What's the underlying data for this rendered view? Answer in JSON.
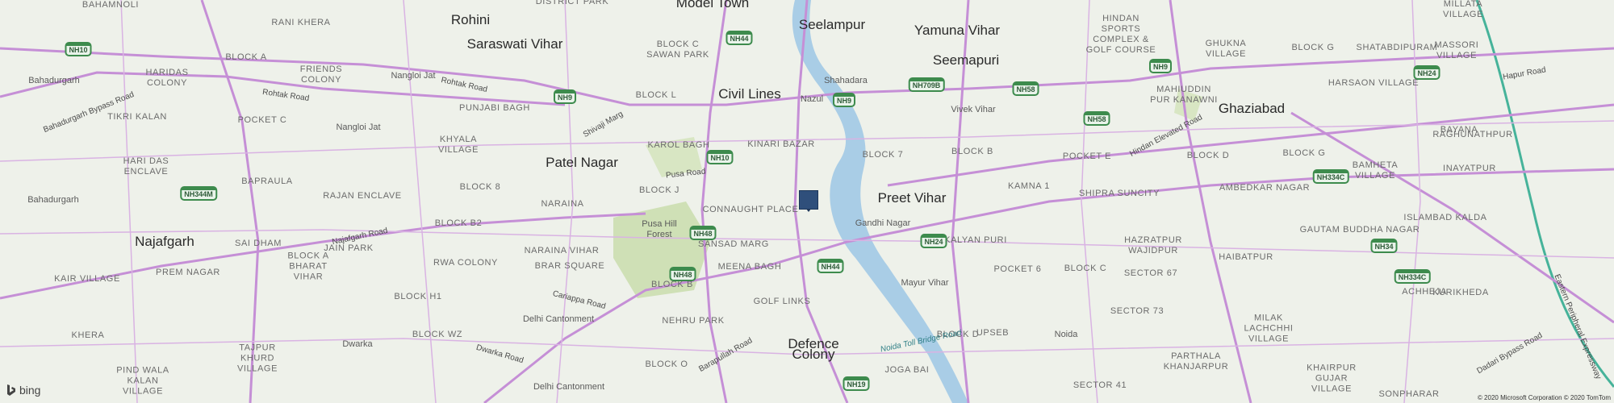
{
  "map": {
    "cities": [
      {
        "text": "Rohini"
      },
      {
        "text": "Saraswati Vihar"
      },
      {
        "text": "Model Town"
      },
      {
        "text": "Seelampur"
      },
      {
        "text": "Yamuna Vihar"
      },
      {
        "text": "Seemapuri"
      },
      {
        "text": "Civil Lines"
      },
      {
        "text": "Patel Nagar"
      },
      {
        "text": "Preet Vihar"
      },
      {
        "text": "Najafgarh"
      },
      {
        "text": "Defence Colony"
      },
      {
        "text": "Ghaziabad"
      }
    ],
    "localities": [
      {
        "text": "Bahadurgarh"
      },
      {
        "text": "Nangloi Jat"
      },
      {
        "text": "Nangloi Jat"
      },
      {
        "text": "Bahadurgarh"
      },
      {
        "text": "Shahadara"
      },
      {
        "text": "Nazul"
      },
      {
        "text": "Vivek Vihar"
      },
      {
        "text": "Gandhi Nagar"
      },
      {
        "text": "Mayur Vihar"
      },
      {
        "text": "Delhi Cantonment"
      },
      {
        "text": "Dwarka"
      },
      {
        "text": "Noida"
      },
      {
        "text": "Delhi Cantonment"
      },
      {
        "text": "Pusa Hill Forest"
      }
    ],
    "areas": [
      {
        "text": "BAHAMNOLI"
      },
      {
        "text": "RANI KHERA"
      },
      {
        "text": "DISTRICT PARK"
      },
      {
        "text": "BLOCK C SAWAN PARK"
      },
      {
        "text": "HARIDAS COLONY"
      },
      {
        "text": "BLOCK A"
      },
      {
        "text": "FRIENDS COLONY"
      },
      {
        "text": "PUNJABI BAGH"
      },
      {
        "text": "BLOCK L"
      },
      {
        "text": "TIKRI KALAN"
      },
      {
        "text": "POCKET C"
      },
      {
        "text": "KHYALA VILLAGE"
      },
      {
        "text": "KAROL BAGH"
      },
      {
        "text": "KINARI BAZAR"
      },
      {
        "text": "HARI DAS ENCLAVE"
      },
      {
        "text": "BAPRAULA"
      },
      {
        "text": "BLOCK 8"
      },
      {
        "text": "BLOCK J"
      },
      {
        "text": "RAJAN ENCLAVE"
      },
      {
        "text": "NARAINA"
      },
      {
        "text": "CONNAUGHT PLACE"
      },
      {
        "text": "BLOCK B2"
      },
      {
        "text": "SAI DHAM"
      },
      {
        "text": "JAIN PARK"
      },
      {
        "text": "BLOCK A BHARAT VIHAR"
      },
      {
        "text": "RWA COLONY"
      },
      {
        "text": "NARAINA VIHAR"
      },
      {
        "text": "SANSAD MARG"
      },
      {
        "text": "BRAR SQUARE"
      },
      {
        "text": "KAIR VILLAGE"
      },
      {
        "text": "PREM NAGAR"
      },
      {
        "text": "MEENA BAGH"
      },
      {
        "text": "BLOCK B"
      },
      {
        "text": "BLOCK H1"
      },
      {
        "text": "GOLF LINKS"
      },
      {
        "text": "KHERA"
      },
      {
        "text": "BLOCK WZ"
      },
      {
        "text": "NEHRU PARK"
      },
      {
        "text": "TAJPUR KHURD VILLAGE"
      },
      {
        "text": "PIND WALA KALAN VILLAGE"
      },
      {
        "text": "BLOCK O"
      },
      {
        "text": "BLOCK 7"
      },
      {
        "text": "BLOCK B"
      },
      {
        "text": "POCKET E"
      },
      {
        "text": "KAMNA 1"
      },
      {
        "text": "SHIPRA SUNCITY"
      },
      {
        "text": "KALYAN PURI"
      },
      {
        "text": "POCKET 6"
      },
      {
        "text": "BLOCK C"
      },
      {
        "text": "HAZRATPUR WAJIDPUR"
      },
      {
        "text": "SECTOR 67"
      },
      {
        "text": "SECTOR 73"
      },
      {
        "text": "UPSEB"
      },
      {
        "text": "BLOCK D"
      },
      {
        "text": "PARTHALA KHANJARPUR"
      },
      {
        "text": "JOGA BAI"
      },
      {
        "text": "SECTOR 41"
      },
      {
        "text": "HINDAN SPORTS COMPLEX & GOLF COURSE"
      },
      {
        "text": "GHUKNA VILLAGE"
      },
      {
        "text": "MAHIUDDIN PUR KANAWNI"
      },
      {
        "text": "BLOCK G"
      },
      {
        "text": "SHATABDIPURAM"
      },
      {
        "text": "HARSAON VILLAGE"
      },
      {
        "text": "BLOCK D"
      },
      {
        "text": "BLOCK G"
      },
      {
        "text": "BAMHETA VILLAGE"
      },
      {
        "text": "AMBEDKAR NAGAR"
      },
      {
        "text": "GAUTAM BUDDHA NAGAR"
      },
      {
        "text": "HAIBATPUR"
      },
      {
        "text": "MILAK LACHCHHI VILLAGE"
      },
      {
        "text": "KHAIRPUR GUJAR VILLAGE"
      },
      {
        "text": "SONPHARAR"
      },
      {
        "text": "ISLAMBAD KALDA"
      },
      {
        "text": "INAYATPUR"
      },
      {
        "text": "RAGHUNATHPUR"
      },
      {
        "text": "BAYANA"
      },
      {
        "text": "MASSORI VILLAGE"
      },
      {
        "text": "MILLATA VILLAGE"
      },
      {
        "text": "ACHHEJA"
      },
      {
        "text": "KURIKHEDA"
      }
    ],
    "shields": [
      {
        "text": "NH10"
      },
      {
        "text": "NH9"
      },
      {
        "text": "NH44"
      },
      {
        "text": "NH9"
      },
      {
        "text": "NH709B"
      },
      {
        "text": "NH58"
      },
      {
        "text": "NH9"
      },
      {
        "text": "NH24"
      },
      {
        "text": "NH58"
      },
      {
        "text": "NH10"
      },
      {
        "text": "NH344M"
      },
      {
        "text": "NH48"
      },
      {
        "text": "NH48"
      },
      {
        "text": "NH44"
      },
      {
        "text": "NH24"
      },
      {
        "text": "NH334C"
      },
      {
        "text": "NH34"
      },
      {
        "text": "NH334C"
      },
      {
        "text": "NH19"
      }
    ],
    "roads": [
      {
        "text": "Rohtak Road"
      },
      {
        "text": "Rohtak Road"
      },
      {
        "text": "Bahadurgarh Bypass Road"
      },
      {
        "text": "Shivaji Marg"
      },
      {
        "text": "Pusa Road"
      },
      {
        "text": "Najafgarh Road"
      },
      {
        "text": "Cariappa Road"
      },
      {
        "text": "Dwarka Road"
      },
      {
        "text": "Barapullah Road"
      },
      {
        "text": "Hindan Elevated Road"
      },
      {
        "text": "Hapur Road"
      },
      {
        "text": "Dadari Bypass Road"
      },
      {
        "text": "Eastern Peripheral Expressway"
      }
    ],
    "water_roads": [
      {
        "text": "Noida Toll Bridge Road"
      }
    ],
    "marker": {
      "icon": "location-marker-icon",
      "color": "#2f4f7b"
    },
    "colors": {
      "road": "#c58fd6",
      "major_road": "#b77fcb",
      "water": "#a9cde6",
      "park": "#cfe0b6",
      "expressway": "#46b39a"
    }
  },
  "footer": {
    "logo_text": "bing",
    "copyright": "© 2020 Microsoft Corporation © 2020 TomTom"
  }
}
